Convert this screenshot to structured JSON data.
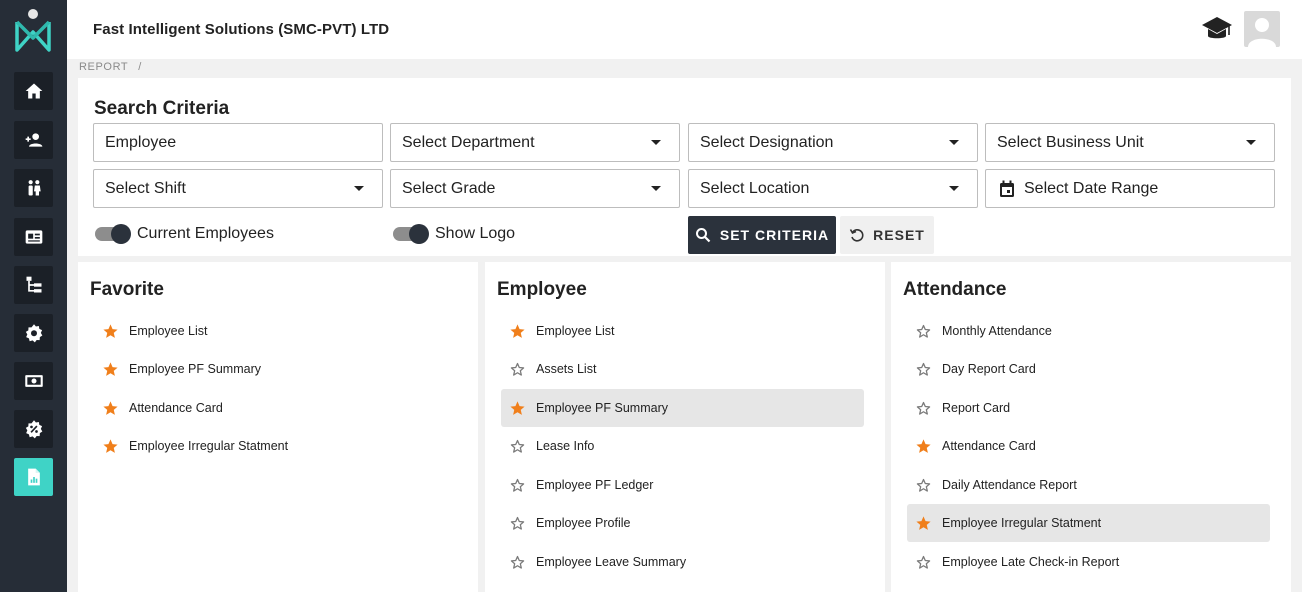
{
  "header": {
    "company": "Fast Intelligent Solutions (SMC-PVT) LTD"
  },
  "breadcrumb": {
    "item": "REPORT",
    "separator": "/"
  },
  "sidebar": {
    "items": [
      {
        "icon": "home-icon"
      },
      {
        "icon": "add-user-icon"
      },
      {
        "icon": "people-icon"
      },
      {
        "icon": "id-card-icon"
      },
      {
        "icon": "org-tree-icon"
      },
      {
        "icon": "settings-icon"
      },
      {
        "icon": "money-icon"
      },
      {
        "icon": "discount-icon"
      },
      {
        "icon": "report-icon",
        "active": true
      }
    ]
  },
  "search": {
    "title": "Search Criteria",
    "fields": {
      "employee": "Employee",
      "department": "Select Department",
      "designation": "Select Designation",
      "business_unit": "Select Business Unit",
      "shift": "Select Shift",
      "grade": "Select Grade",
      "location": "Select Location",
      "date_range": "Select Date Range"
    },
    "toggles": {
      "current_employees": "Current Employees",
      "show_logo": "Show Logo"
    },
    "buttons": {
      "set": "SET CRITERIA",
      "reset": "RESET"
    }
  },
  "panels": {
    "favorite": {
      "title": "Favorite",
      "items": [
        {
          "label": "Employee List",
          "fav": true
        },
        {
          "label": "Employee PF Summary",
          "fav": true
        },
        {
          "label": "Attendance Card",
          "fav": true
        },
        {
          "label": "Employee Irregular Statment",
          "fav": true
        }
      ]
    },
    "employee": {
      "title": "Employee",
      "items": [
        {
          "label": "Employee List",
          "fav": true
        },
        {
          "label": "Assets List",
          "fav": false
        },
        {
          "label": "Employee PF Summary",
          "fav": true,
          "highlighted": true
        },
        {
          "label": "Lease Info",
          "fav": false
        },
        {
          "label": "Employee PF Ledger",
          "fav": false
        },
        {
          "label": "Employee Profile",
          "fav": false
        },
        {
          "label": "Employee Leave Summary",
          "fav": false
        }
      ]
    },
    "attendance": {
      "title": "Attendance",
      "items": [
        {
          "label": "Monthly Attendance",
          "fav": false
        },
        {
          "label": "Day Report Card",
          "fav": false
        },
        {
          "label": "Report Card",
          "fav": false
        },
        {
          "label": "Attendance Card",
          "fav": true
        },
        {
          "label": "Daily Attendance Report",
          "fav": false
        },
        {
          "label": "Employee Irregular Statment",
          "fav": true,
          "highlighted": true
        },
        {
          "label": "Employee Late Check-in Report",
          "fav": false
        }
      ]
    }
  },
  "colors": {
    "star_filled": "#f07f1b",
    "star_empty": "#7a7a7a",
    "accent": "#3fd3c6",
    "sidebar": "#262d37"
  }
}
